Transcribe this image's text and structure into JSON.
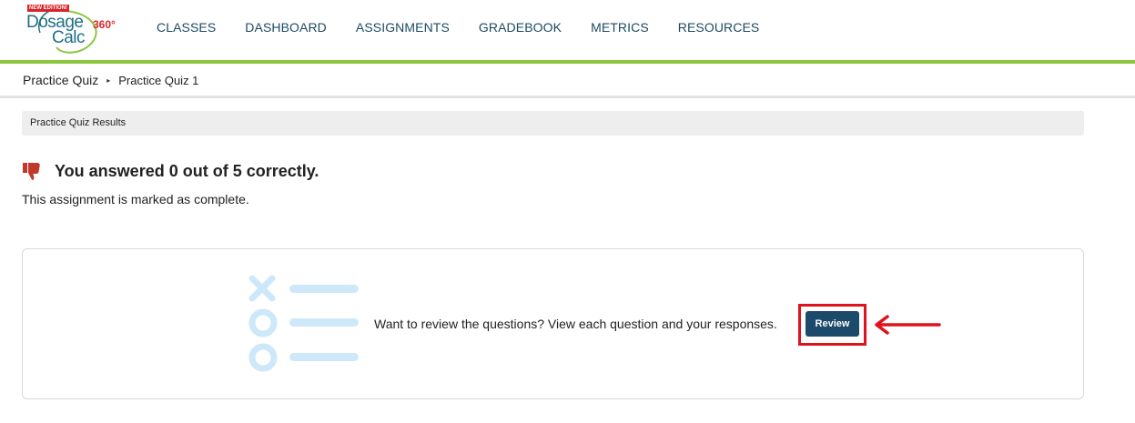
{
  "header": {
    "logo": {
      "badge": "NEW EDITION!",
      "line1": "Dosage",
      "line2": "Calc",
      "degrees": "360°"
    },
    "nav": [
      {
        "label": "CLASSES"
      },
      {
        "label": "DASHBOARD"
      },
      {
        "label": "ASSIGNMENTS"
      },
      {
        "label": "GRADEBOOK"
      },
      {
        "label": "METRICS"
      },
      {
        "label": "RESOURCES"
      }
    ],
    "accent_color": "#8cc63f",
    "nav_color": "#1c4a63"
  },
  "breadcrumb": {
    "items": [
      "Practice Quiz",
      "Practice Quiz 1"
    ],
    "separator": "▸"
  },
  "results": {
    "bar_title": "Practice Quiz Results",
    "score_text": "You answered 0 out of 5 correctly.",
    "status_text": "This assignment is marked as complete.",
    "score_icon": "thumbs-down-icon",
    "score_icon_color": "#c0392b"
  },
  "review": {
    "prompt": "Want to review the questions? View each question and your responses.",
    "button_label": "Review",
    "button_color": "#1b4a6b",
    "highlight_color": "#e0121b",
    "illustration_icon": "quiz-checklist-icon"
  }
}
